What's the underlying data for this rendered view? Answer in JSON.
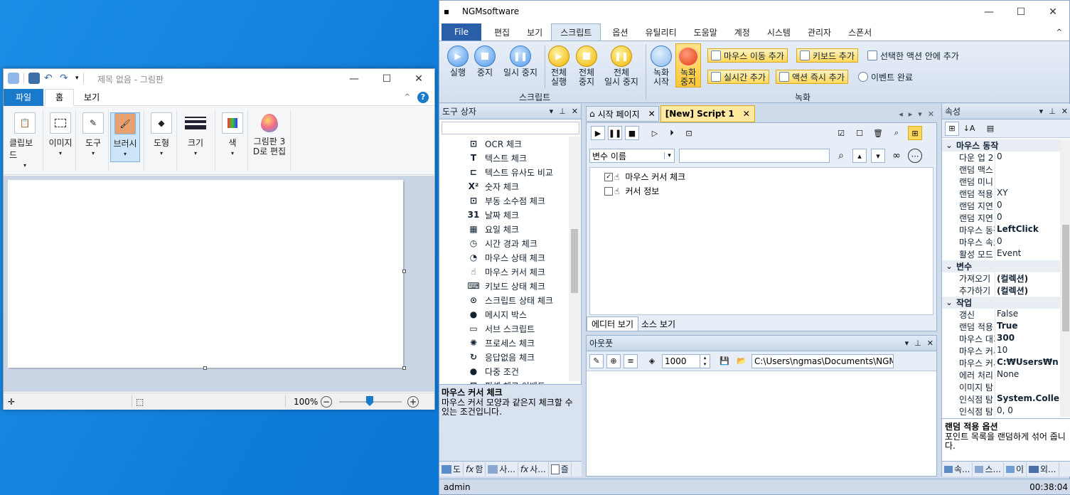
{
  "paint": {
    "title": "제목 없음 - 그림판",
    "tabs": [
      "파일",
      "홈",
      "보기"
    ],
    "help_icon": "?",
    "ribbon": [
      {
        "label": "클립보드"
      },
      {
        "label": "이미지"
      },
      {
        "label": "도구"
      },
      {
        "label": "브러시"
      },
      {
        "label": "도형"
      },
      {
        "label": "크기"
      },
      {
        "label": "색"
      },
      {
        "label_l1": "그림판 3",
        "label_l2": "D로 편집"
      }
    ],
    "zoom": "100%"
  },
  "ngm": {
    "title": "NGMsoftware",
    "tabs": [
      "File",
      "편집",
      "보기",
      "스크립트",
      "옵션",
      "유틸리티",
      "도움말",
      "계정",
      "시스템",
      "관리자",
      "스폰서"
    ],
    "ribbon": {
      "script_buttons": [
        {
          "l1": "실행",
          "l2": ""
        },
        {
          "l1": "중지",
          "l2": ""
        },
        {
          "l1": "일시 중지",
          "l2": ""
        },
        {
          "l1": "전체",
          "l2": "실행"
        },
        {
          "l1": "전체",
          "l2": "중지"
        },
        {
          "l1": "전체",
          "l2": "일시 중지"
        }
      ],
      "script_group": "스크립트",
      "rec_buttons": [
        {
          "l1": "녹화",
          "l2": "시작"
        },
        {
          "l1": "녹화",
          "l2": "중지"
        }
      ],
      "rec_actions": [
        "마우스 이동 추가",
        "키보드 추가",
        "선택한 액션 안에 추가",
        "실시간 추가",
        "액션 즉시 추가",
        "이벤트 완료"
      ],
      "rec_group": "녹화"
    },
    "toolbox": {
      "title": "도구 상자",
      "items": [
        {
          "icon": "ocr-icon",
          "glyph": "⊡",
          "label": "OCR 체크"
        },
        {
          "icon": "text-icon",
          "glyph": "T",
          "label": "텍스트 체크"
        },
        {
          "icon": "text-compare-icon",
          "glyph": "⊏",
          "label": "텍스트 유사도 비교"
        },
        {
          "icon": "number-icon",
          "glyph": "X²",
          "label": "숫자 체크"
        },
        {
          "icon": "decimal-icon",
          "glyph": "⊡",
          "label": "부동 소수점 체크"
        },
        {
          "icon": "calendar-icon",
          "glyph": "31",
          "label": "날짜 체크"
        },
        {
          "icon": "weekday-icon",
          "glyph": "▦",
          "label": "요일 체크"
        },
        {
          "icon": "timer-icon",
          "glyph": "◷",
          "label": "시간 경과 체크"
        },
        {
          "icon": "mouse-icon",
          "glyph": "◔",
          "label": "마우스 상태 체크"
        },
        {
          "icon": "cursor-icon",
          "glyph": "☝",
          "label": "마우스 커서 체크"
        },
        {
          "icon": "keyboard-icon",
          "glyph": "⌨",
          "label": "키보드 상태 체크"
        },
        {
          "icon": "script-state-icon",
          "glyph": "⊙",
          "label": "스크립트 상태 체크"
        },
        {
          "icon": "message-icon",
          "glyph": "●",
          "label": "메시지 박스"
        },
        {
          "icon": "subscript-icon",
          "glyph": "▭",
          "label": "서브 스크립트"
        },
        {
          "icon": "process-icon",
          "glyph": "✺",
          "label": "프로세스 체크"
        },
        {
          "icon": "no-response-icon",
          "glyph": "↻",
          "label": "응답없음 체크"
        },
        {
          "icon": "multi-condition-icon",
          "glyph": "●",
          "label": "다중 조건"
        },
        {
          "icon": "pixel-event-icon",
          "glyph": "⊞",
          "label": "픽셀 체크 이벤트"
        }
      ],
      "desc_title": "마우스 커서 체크",
      "desc_text": "마우스 커서 모양과 같은지 체크할 수 있는 조건입니다.",
      "bottom_tabs": [
        "도",
        "함",
        "사...",
        "사...",
        "즐"
      ]
    },
    "editor": {
      "tabs": [
        "시작 페이지",
        "[New] Script 1"
      ],
      "var_select": "변수 이름",
      "rows": [
        {
          "checked": true,
          "label": "마우스 커서 체크"
        },
        {
          "checked": false,
          "label": "커서 정보"
        }
      ],
      "view_tabs": [
        "에디터 보기",
        "소스 보기"
      ]
    },
    "output": {
      "title": "아웃풋",
      "count": "1000",
      "path": "C:\\Users\\ngmas\\Documents\\NGM6\\"
    },
    "props": {
      "title": "속성",
      "categories": [
        {
          "name": "마우스 동작",
          "rows": [
            {
              "k": "다운 업 2",
              "v": "0",
              "b": false
            },
            {
              "k": "랜덤 맥스",
              "v": "",
              "b": false
            },
            {
              "k": "랜덤 미니",
              "v": "",
              "b": false
            },
            {
              "k": "랜덤 적용",
              "v": "XY",
              "b": false
            },
            {
              "k": "랜덤 지연",
              "v": "0",
              "b": false
            },
            {
              "k": "랜덤 지연",
              "v": "0",
              "b": false
            },
            {
              "k": "마우스 동작",
              "v": "LeftClick",
              "b": true
            },
            {
              "k": "마우스 속도",
              "v": "0",
              "b": false
            },
            {
              "k": "활성 모드",
              "v": "Event",
              "b": false
            }
          ]
        },
        {
          "name": "변수",
          "rows": [
            {
              "k": "가져오기",
              "v": "(컬렉션)",
              "b": true
            },
            {
              "k": "추가하기",
              "v": "(컬렉션)",
              "b": true
            }
          ]
        },
        {
          "name": "작업",
          "rows": [
            {
              "k": "갱신",
              "v": "False",
              "b": false
            },
            {
              "k": "랜덤 적용",
              "v": "True",
              "b": true
            },
            {
              "k": "마우스 대기",
              "v": "300",
              "b": true
            },
            {
              "k": "마우스 커서",
              "v": "10",
              "b": false
            },
            {
              "k": "마우스 커서",
              "v": "C:₩Users₩n",
              "b": true
            },
            {
              "k": "에러 처리",
              "v": "None",
              "b": false
            },
            {
              "k": "이미지 탐",
              "v": "",
              "b": false
            },
            {
              "k": "인식점 탐",
              "v": "System.Colle",
              "b": true
            },
            {
              "k": "인식점 탐",
              "v": "0, 0",
              "b": false
            }
          ]
        }
      ],
      "desc_title": "랜덤 적용 옵션",
      "desc_text": "포인트 목록을 랜덤하게 섞어 줍니다.",
      "bottom_tabs": [
        "속...",
        "스...",
        "이",
        "외..."
      ]
    },
    "status": {
      "user": "admin",
      "time": "00:38:04"
    }
  }
}
